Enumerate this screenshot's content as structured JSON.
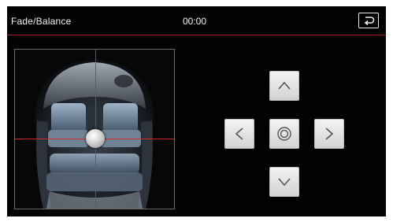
{
  "header": {
    "title": "Fade/Balance",
    "time": "00:00"
  },
  "icons": {
    "back": "return-arrow-icon",
    "up": "chevron-up-icon",
    "down": "chevron-down-icon",
    "left": "chevron-left-icon",
    "right": "chevron-right-icon",
    "center": "concentric-circle-icon"
  },
  "colors": {
    "background": "#020202",
    "accent_line": "#b02020",
    "crosshair": "#d42a2a",
    "button_face": "#e6e6e6",
    "text": "#f2f2f2"
  }
}
